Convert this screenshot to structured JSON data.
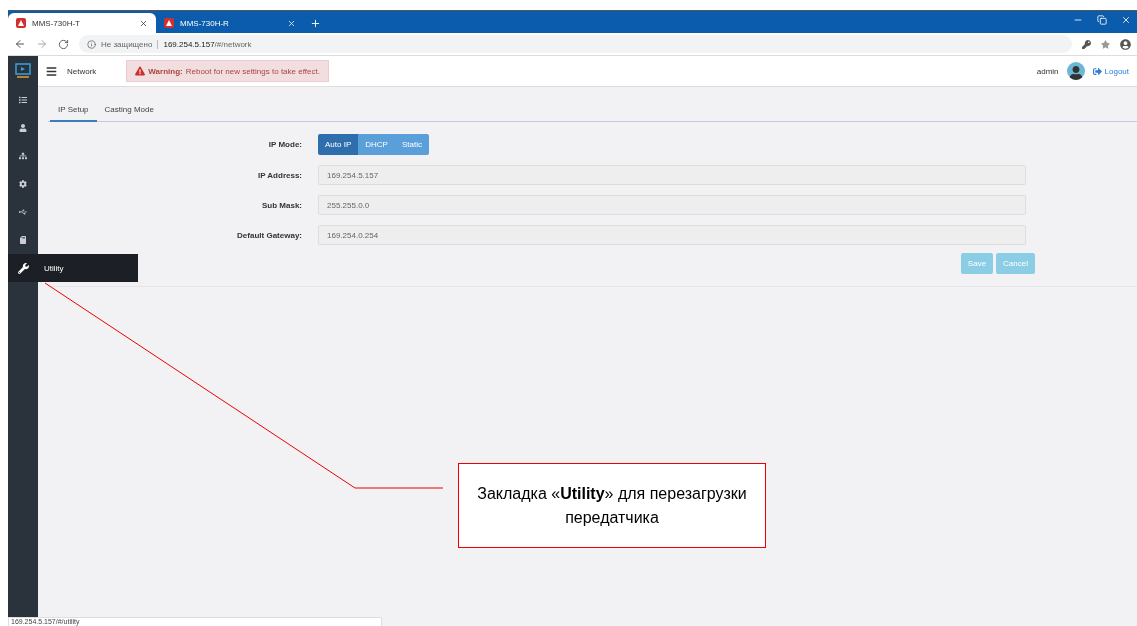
{
  "browser": {
    "tabs": [
      {
        "title": "MMS-730H-T",
        "selected": true
      },
      {
        "title": "MMS-730H-R",
        "selected": false
      }
    ],
    "security": "Не защищено",
    "url_host": "169.254.5.157",
    "url_path": "/#/network",
    "status_url": "169.254.5.157/#/utility"
  },
  "header": {
    "title": "Network",
    "warning_label": "Warning:",
    "warning_text": "Reboot for new settings to take effect.",
    "user": "admin",
    "logout": "Logout"
  },
  "sidebar": {
    "items": [
      {
        "kind": "list",
        "selected": false
      },
      {
        "kind": "user",
        "selected": false
      },
      {
        "kind": "sitemap",
        "selected": false
      },
      {
        "kind": "gear",
        "selected": false
      },
      {
        "kind": "usb",
        "selected": false
      },
      {
        "kind": "card",
        "selected": false
      },
      {
        "kind": "wrench",
        "selected": true,
        "label": "Utility"
      }
    ]
  },
  "tabs": [
    {
      "label": "IP Setup",
      "selected": true
    },
    {
      "label": "Casting Mode",
      "selected": false
    }
  ],
  "form": {
    "mode_label": "IP Mode:",
    "modes": [
      {
        "label": "Auto IP",
        "selected": true
      },
      {
        "label": "DHCP",
        "selected": false
      },
      {
        "label": "Static",
        "selected": false
      }
    ],
    "fields": [
      {
        "label": "IP Address:",
        "value": "169.254.5.157"
      },
      {
        "label": "Sub Mask:",
        "value": "255.255.0.0"
      },
      {
        "label": "Default Gateway:",
        "value": "169.254.0.254"
      }
    ],
    "buttons": [
      "Save",
      "Cancel"
    ]
  },
  "callout": {
    "text": "Закладка «**Utility**» для перезагрузки передатчика"
  }
}
